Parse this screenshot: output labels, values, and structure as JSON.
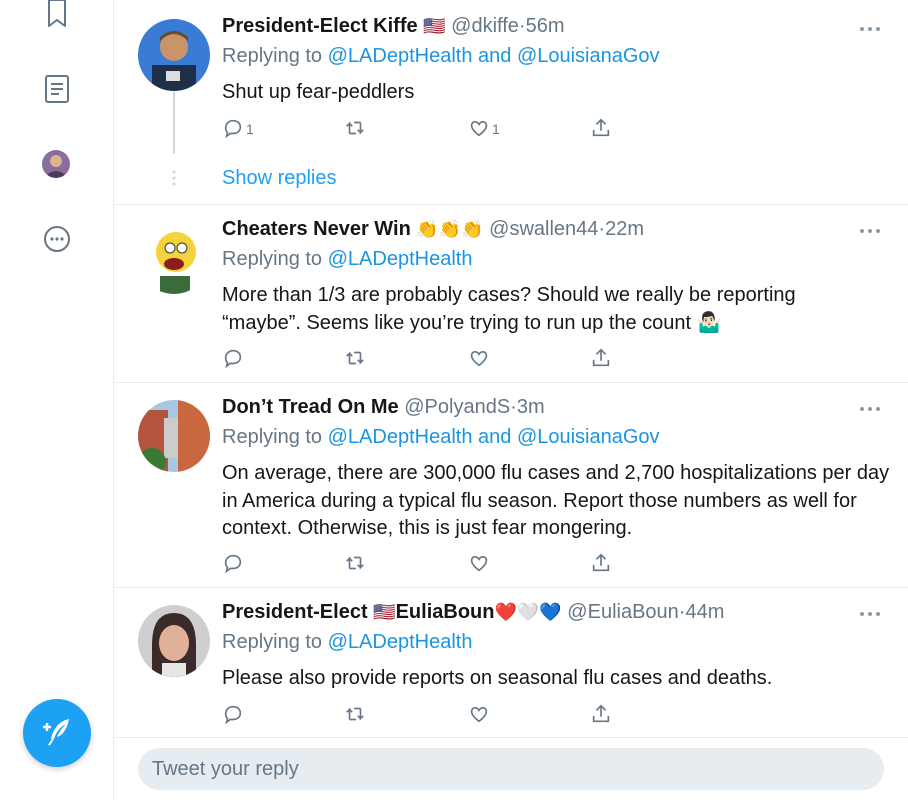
{
  "sidebar": {
    "icons": [
      "bookmark-icon",
      "lists-icon",
      "profile-avatar",
      "more-icon"
    ],
    "compose_icon": "compose-tweet-icon",
    "accent": "#1da1f2"
  },
  "tweets": [
    {
      "name": "President-Elect Kiffe",
      "name_emoji": "🇺🇸",
      "handle": "@dkiffe",
      "time": "56m",
      "replying_prefix": "Replying to ",
      "reply_to_1": "@LADeptHealth",
      "reply_and": " and ",
      "reply_to_2": "@LouisianaGov",
      "text": "Shut up fear-peddlers",
      "reply_count": "1",
      "like_count": "1",
      "show_replies": "Show replies"
    },
    {
      "name": "Cheaters Never Win",
      "name_emoji": "👏👏👏",
      "handle": "@swallen44",
      "time": "22m",
      "replying_prefix": "Replying to ",
      "reply_to_1": "@LADeptHealth",
      "text": "More than 1/3 are probably cases?  Should we really be reporting “maybe”.  Seems like you’re trying to run up the count 🤷🏻‍♂️"
    },
    {
      "name": "Don’t Tread On Me",
      "handle": "@PolyandS",
      "time": "3m",
      "replying_prefix": "Replying to ",
      "reply_to_1": "@LADeptHealth",
      "reply_and": " and ",
      "reply_to_2": "@LouisianaGov",
      "text": "On average, there are 300,000 flu cases and 2,700 hospitalizations per day in America during a typical flu season.  Report those numbers as well for context. Otherwise, this is just fear mongering."
    },
    {
      "name": "President-Elect ",
      "name_emoji": "🇺🇸",
      "name_tail": "EuliaBoun",
      "name_hearts": "❤️🤍💙",
      "handle": "@EuliaBoun",
      "time": "44m",
      "replying_prefix": "Replying to ",
      "reply_to_1": "@LADeptHealth",
      "text": "Please also provide reports on seasonal flu cases and deaths."
    }
  ],
  "sep": "·",
  "reply_placeholder": "Tweet your reply"
}
